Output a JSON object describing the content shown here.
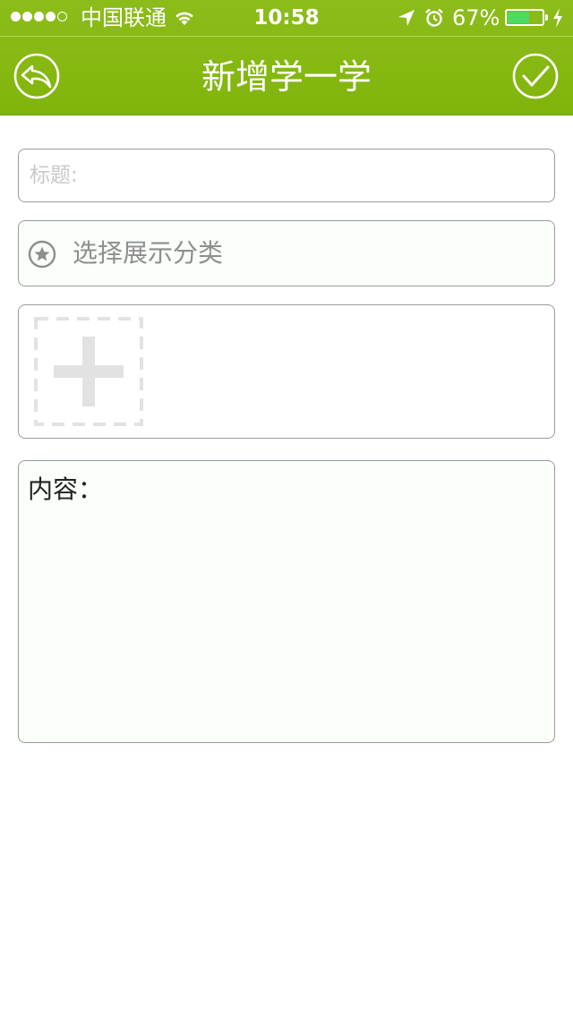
{
  "status_bar": {
    "signal_filled": 4,
    "signal_total": 5,
    "carrier": "中国联通",
    "time": "10:58",
    "battery_percent_text": "67%",
    "battery_level": 0.67,
    "icons": [
      "wifi-icon",
      "location-arrow-icon",
      "alarm-clock-icon",
      "battery-icon",
      "charging-bolt-icon"
    ]
  },
  "nav": {
    "title": "新增学一学",
    "back_icon": "reply-arrow-icon",
    "confirm_icon": "checkmark-circle-icon"
  },
  "form": {
    "title_placeholder": "标题:",
    "title_value": "",
    "category_label": "选择展示分类",
    "category_icon": "star-circle-icon",
    "add_image_icon": "plus-dashed-icon",
    "content_label": "内容：",
    "content_value": ""
  },
  "colors": {
    "header_green": "#86b812",
    "battery_green": "#4cd964",
    "field_border": "#9a9a9a",
    "placeholder_gray": "#c8c8c8"
  }
}
